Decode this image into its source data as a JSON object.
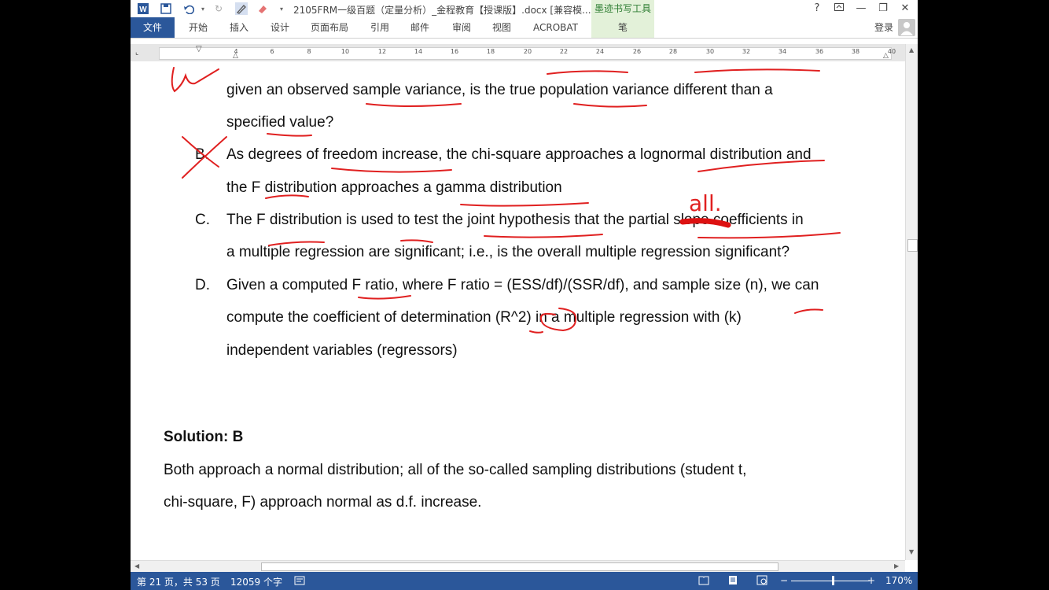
{
  "titlebar": {
    "title": "2105FRM一级百题（定量分析）_金程教育【授课版】.docx [兼容模...",
    "ink_tools_tab": "墨迹书写工具",
    "help": "?",
    "min": "—",
    "restore": "❐",
    "close": "✕"
  },
  "ribbon": {
    "file_tab": "文件",
    "tabs": [
      "开始",
      "插入",
      "设计",
      "页面布局",
      "引用",
      "邮件",
      "审阅",
      "视图",
      "ACROBAT"
    ],
    "pen_tab": "笔",
    "login": "登录"
  },
  "ruler": {
    "numbers": [
      "4",
      "6",
      "8",
      "10",
      "12",
      "14",
      "16",
      "18",
      "20",
      "22",
      "24",
      "26",
      "28",
      "30",
      "32",
      "34",
      "36",
      "38",
      "40"
    ]
  },
  "document": {
    "lines": [
      "given an observed sample variance, is the true population variance different than a",
      "specified value?",
      "As degrees of freedom increase, the chi-square approaches a lognormal distribution and",
      "the F distribution approaches a gamma distribution",
      "The F distribution is used to test the joint hypothesis that the partial slope coefficients in",
      "a multiple regression are significant; i.e., is the overall multiple regression significant?",
      "Given a computed F ratio, where F ratio = (ESS/df)/(SSR/df), and sample size (n), we can",
      "compute the coefficient of determination (R^2) in a multiple regression with (k)",
      "independent variables (regressors)"
    ],
    "letters": [
      "B.",
      "C.",
      "D."
    ],
    "solution_title": "Solution: B",
    "solution_lines": [
      "Both approach a normal distribution; all of the so-called sampling distributions (student t,",
      "chi-square, F) approach normal as d.f. increase."
    ],
    "ink_note": "all."
  },
  "status": {
    "page": "第 21 页，共 53 页",
    "words": "12059 个字",
    "zoom": "170%"
  },
  "colors": {
    "brand": "#2b579a",
    "ink": "#e02020",
    "ink_tab": "#e3f1d9"
  }
}
